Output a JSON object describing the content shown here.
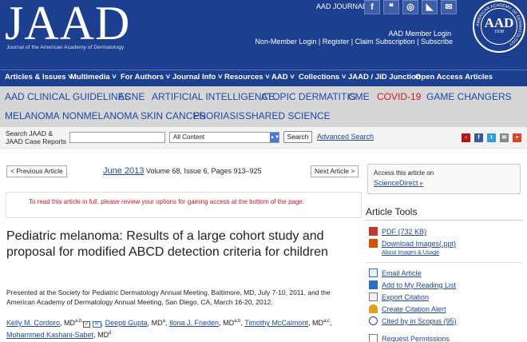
{
  "header": {
    "logo": "JAAD",
    "logo_subtitle": "Journal of the American Academy of Dermatology",
    "journals_label": "AAD JOURNALS",
    "social": [
      {
        "icon": "facebook-icon",
        "glyph": "f"
      },
      {
        "icon": "feed-icon",
        "glyph": "❝"
      },
      {
        "icon": "instagram-icon",
        "glyph": "◎"
      },
      {
        "icon": "rss-icon",
        "glyph": "◣"
      },
      {
        "icon": "email-icon",
        "glyph": "✉"
      }
    ],
    "member_login": "AAD Member Login",
    "links": [
      "Non-Member Login",
      "Register",
      "Claim Subscription",
      "Subscribe"
    ],
    "seal": {
      "abbr": "AAD",
      "year": "1938",
      "ring_text": "AMERICAN ACADEMY OF DERMATOLOGY"
    }
  },
  "nav": [
    "Articles & Issues ˅",
    "Multimedia ˅",
    "For Authors ˅",
    "Journal Info ˅",
    "Resources ˅",
    "AAD ˅",
    "Collections ˅",
    "JAAD / JID Junction",
    "Open Access Articles"
  ],
  "topics": {
    "row1": [
      "AAD CLINICAL GUIDELINES",
      "ACNE",
      "ARTIFICIAL INTELLIGENCE",
      "ATOPIC DERMATITIS",
      "CME",
      "COVID-19",
      "GAME CHANGERS"
    ],
    "row2": [
      "MELANOMA",
      "NONMELANOMA SKIN CANCER",
      "PSORIASIS",
      "SHARED SCIENCE"
    ]
  },
  "search": {
    "label": "Search JAAD & JAAD Case Reports",
    "input_value": "",
    "scope_selected": "All Content",
    "button": "Search",
    "advanced": "Advanced Search"
  },
  "share_icons": [
    {
      "icon": "mendeley-icon",
      "glyph": "∩",
      "color": "#b5121b"
    },
    {
      "icon": "facebook-icon",
      "glyph": "f",
      "color": "#3b5998"
    },
    {
      "icon": "twitter-icon",
      "glyph": "t",
      "color": "#2fa1d9"
    },
    {
      "icon": "email-icon",
      "glyph": "✉",
      "color": "#888888"
    },
    {
      "icon": "plus-icon",
      "glyph": "+",
      "color": "#d9472b"
    }
  ],
  "article_nav": {
    "prev": "< Previous Article",
    "next": "Next Article >",
    "date": "June 2013",
    "volume": "Volume 68, Issue 6, Pages 913–925"
  },
  "access_message": "To read this article in full, please review your options for gaining access at the bottom of the page.",
  "article": {
    "title": "Pediatric melanoma: Results of a large cohort study and proposal for modified ABCD detection criteria for children",
    "presented": "Presented at the Society for Pediatric Dermatology Annual Meeting, Baltimore, MD, July 7-10, 2011, and the American Academy of Dermatology Annual Meeting, San Diego, CA, March 16-20, 2012.",
    "authors": [
      {
        "name": "Kelly M. Cordoro",
        "aff": "a,b,"
      },
      {
        "name": "Deepti Gupta",
        "aff": "a"
      },
      {
        "name": "Ilona J. Frieden",
        "aff": "a,b"
      },
      {
        "name": "Timothy McCalmont",
        "aff": "a,c"
      },
      {
        "name": "Mohammed Kashani-Sabet",
        "aff": "d"
      }
    ],
    "degree": "MD"
  },
  "sidebar": {
    "access_text": "Access this article on",
    "sd_link": "ScienceDirect",
    "tools_title": "Article Tools",
    "tools": [
      {
        "label": "PDF (732 KB)",
        "icon": "pdf-icon",
        "color": "#c0392b"
      },
      {
        "label": "Download Images(.ppt)",
        "icon": "ppt-icon",
        "color": "#d35400"
      },
      {
        "label": "Email Article",
        "icon": "email-icon",
        "color": "#2c6fbf"
      },
      {
        "label": "Add to My Reading List",
        "icon": "reading-list-icon",
        "color": "#2c6fbf"
      },
      {
        "label": "Export Citation",
        "icon": "export-icon",
        "color": "#777777"
      },
      {
        "label": "Create Citation Alert",
        "icon": "bell-icon",
        "color": "#e0a020"
      },
      {
        "label": "Cited by in Scopus (95)",
        "icon": "scopus-icon",
        "color": "#1f48a6"
      },
      {
        "label": "Request Permissions",
        "icon": "permissions-icon",
        "color": "#777777"
      }
    ],
    "about_images": "About Images & Usage"
  }
}
